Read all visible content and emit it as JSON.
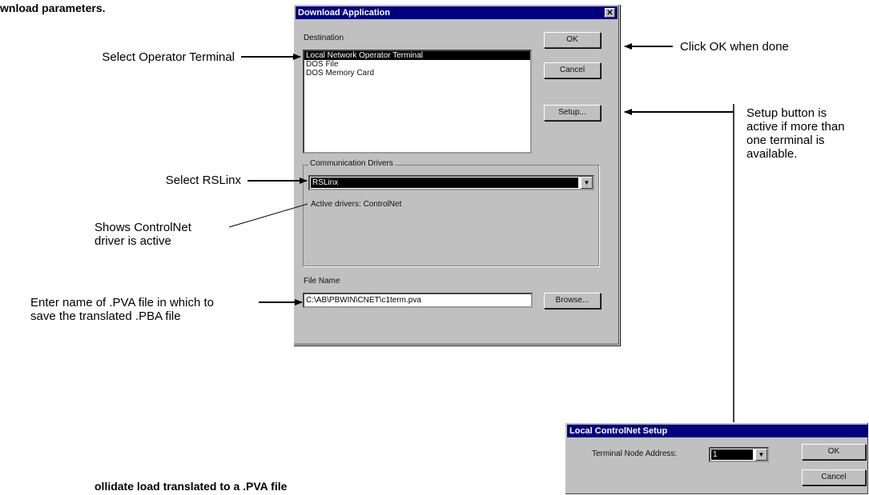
{
  "page": {
    "header_text": "wnload parameters.",
    "footer_text": "ollidate load translated to a .PVA file"
  },
  "callouts": {
    "select_terminal": "Select Operator Terminal",
    "click_ok": "Click OK when done",
    "setup_note": [
      "Setup button is",
      "active if more than",
      "one terminal is",
      "available."
    ],
    "select_rslinx": "Select RSLinx",
    "shows_controlnet": [
      "Shows ControlNet",
      "driver is active"
    ],
    "enter_name": [
      "Enter name of .PVA file in which to",
      "save the translated .PBA file"
    ]
  },
  "download_dialog": {
    "title": "Download Application",
    "close_glyph": "✕",
    "destination_label": "Destination",
    "destinations": [
      "Local Network Operator Terminal",
      "DOS File",
      "DOS Memory Card"
    ],
    "selected_destination": 0,
    "ok_label": "OK",
    "cancel_label": "Cancel",
    "setup_label": "Setup...",
    "comm_drivers_label": "Communication Drivers",
    "driver_value": "RSLinx",
    "active_drivers_text": "Active drivers: ControlNet",
    "file_name_label": "File Name",
    "file_name_value": "C:\\AB\\PBWIN\\CNET\\c1term.pva",
    "browse_label": "Browse..."
  },
  "setup_dialog": {
    "title": "Local ControlNet Setup",
    "node_address_label": "Terminal Node Address:",
    "node_address_value": "1",
    "ok_label": "OK",
    "cancel_label": "Cancel"
  },
  "colors": {
    "titlebar": "#000080",
    "dialog_face": "#c0c0c0"
  }
}
